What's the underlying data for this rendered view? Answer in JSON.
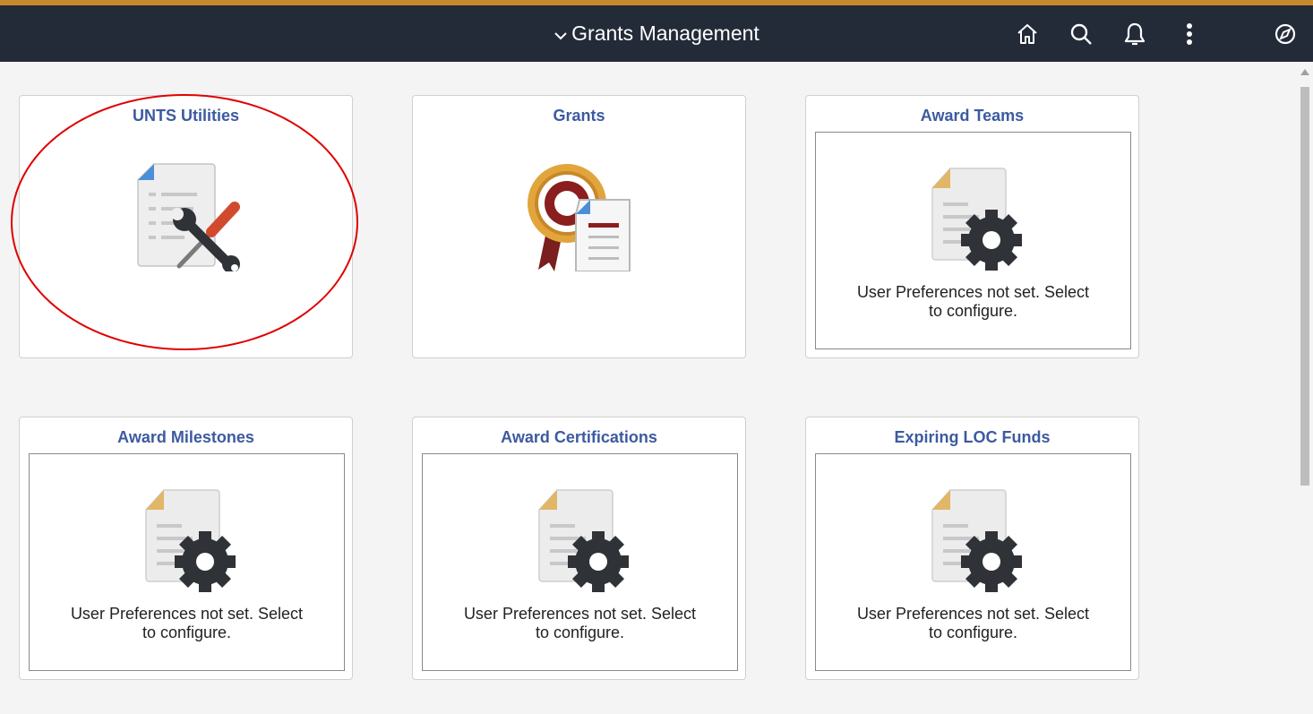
{
  "header": {
    "title": "Grants Management",
    "icons": [
      "home-icon",
      "search-icon",
      "bell-icon",
      "more-vertical-icon",
      "compass-icon"
    ]
  },
  "tiles": [
    {
      "title": "UNTS Utilities",
      "icon": "document-tools-icon"
    },
    {
      "title": "Grants",
      "icon": "award-ribbon-document-icon"
    },
    {
      "title": "Award Teams",
      "icon": "document-gear-icon",
      "message_line1": "User Preferences not set. Select",
      "message_line2": "to configure."
    },
    {
      "title": "Award Milestones",
      "icon": "document-gear-icon",
      "message_line1": "User Preferences not set. Select",
      "message_line2": "to configure."
    },
    {
      "title": "Award Certifications",
      "icon": "document-gear-icon",
      "message_line1": "User Preferences not set. Select",
      "message_line2": "to configure."
    },
    {
      "title": "Expiring LOC Funds",
      "icon": "document-gear-icon",
      "message_line1": "User Preferences not set. Select",
      "message_line2": "to configure."
    }
  ],
  "colors": {
    "header_bg": "#232a38",
    "accent_line": "#c68a2c",
    "tile_title": "#3c5aa0",
    "annotation": "#e00000"
  }
}
